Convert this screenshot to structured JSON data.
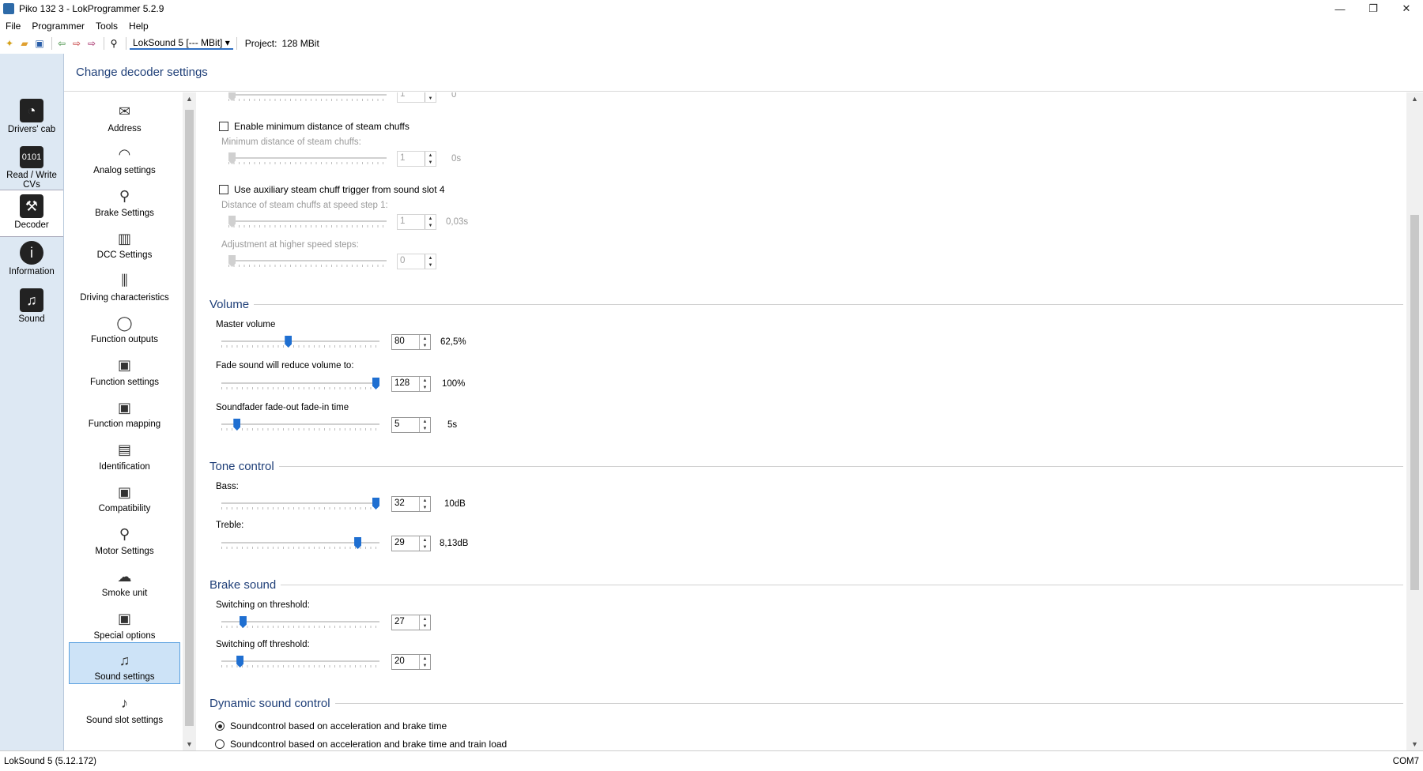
{
  "window": {
    "title": "Piko 132 3 - LokProgrammer 5.2.9",
    "minimize": "—",
    "restore": "❐",
    "close": "✕"
  },
  "menu": [
    "File",
    "Programmer",
    "Tools",
    "Help"
  ],
  "toolbar": {
    "decoder_combo": "LokSound 5 [--- MBit]",
    "project_label": "Project:",
    "project_value": "128 MBit"
  },
  "categories": [
    {
      "label": "Drivers' cab",
      "icon": "cab-icon"
    },
    {
      "label": "Read / Write CVs",
      "icon": "cv-icon"
    },
    {
      "label": "Decoder",
      "icon": "wrench-icon",
      "active": true
    },
    {
      "label": "Information",
      "icon": "info-icon"
    },
    {
      "label": "Sound",
      "icon": "music-icon"
    }
  ],
  "page_title": "Change decoder settings",
  "sublist": [
    {
      "label": "Address",
      "icon": "envelope-icon"
    },
    {
      "label": "Analog settings",
      "icon": "analog-icon"
    },
    {
      "label": "Brake Settings",
      "icon": "brake-icon"
    },
    {
      "label": "DCC Settings",
      "icon": "dcc-icon"
    },
    {
      "label": "Driving characteristics",
      "icon": "sliders-icon"
    },
    {
      "label": "Function outputs",
      "icon": "bulb-icon"
    },
    {
      "label": "Function settings",
      "icon": "function-icon"
    },
    {
      "label": "Function mapping",
      "icon": "mapping-icon"
    },
    {
      "label": "Identification",
      "icon": "id-card-icon"
    },
    {
      "label": "Compatibility",
      "icon": "compat-icon"
    },
    {
      "label": "Motor Settings",
      "icon": "motor-icon"
    },
    {
      "label": "Smoke unit",
      "icon": "smoke-icon"
    },
    {
      "label": "Special options",
      "icon": "options-icon"
    },
    {
      "label": "Sound settings",
      "icon": "sound-settings-icon",
      "active": true
    },
    {
      "label": "Sound slot settings",
      "icon": "sound-slot-icon"
    }
  ],
  "steam": {
    "top_value": "1",
    "top_unit": "0",
    "min_distance_checkbox": "Enable minimum distance of steam chuffs",
    "min_distance_label": "Minimum distance of steam chuffs:",
    "min_distance_value": "1",
    "min_distance_unit": "0s",
    "aux_checkbox": "Use auxiliary steam chuff trigger from sound slot 4",
    "distance_label": "Distance of steam chuffs at speed step 1:",
    "distance_value": "1",
    "distance_unit": "0,03s",
    "adjust_label": "Adjustment at higher speed steps:",
    "adjust_value": "0"
  },
  "volume": {
    "title": "Volume",
    "master_label": "Master volume",
    "master_value": "80",
    "master_unit": "62,5%",
    "fade_label": "Fade sound will reduce volume to:",
    "fade_value": "128",
    "fade_unit": "100%",
    "fader_label": "Soundfader fade-out  fade-in time",
    "fader_value": "5",
    "fader_unit": "5s"
  },
  "tone": {
    "title": "Tone control",
    "bass_label": "Bass:",
    "bass_value": "32",
    "bass_unit": "10dB",
    "treble_label": "Treble:",
    "treble_value": "29",
    "treble_unit": "8,13dB"
  },
  "brake": {
    "title": "Brake sound",
    "on_label": "Switching on threshold:",
    "on_value": "27",
    "off_label": "Switching off threshold:",
    "off_value": "20"
  },
  "dynamic": {
    "title": "Dynamic sound control",
    "option1": "Soundcontrol based on acceleration and brake time",
    "option2": "Soundcontrol based on acceleration and brake time and train load",
    "selected": 1
  },
  "slider_levels": {
    "master": 0.42,
    "fade": 1.0,
    "fader": 0.08,
    "bass": 1.0,
    "treble": 0.88,
    "brake_on": 0.12,
    "brake_off": 0.1
  },
  "status": {
    "left": "LokSound 5 (5.12.172)",
    "right": "COM7"
  }
}
